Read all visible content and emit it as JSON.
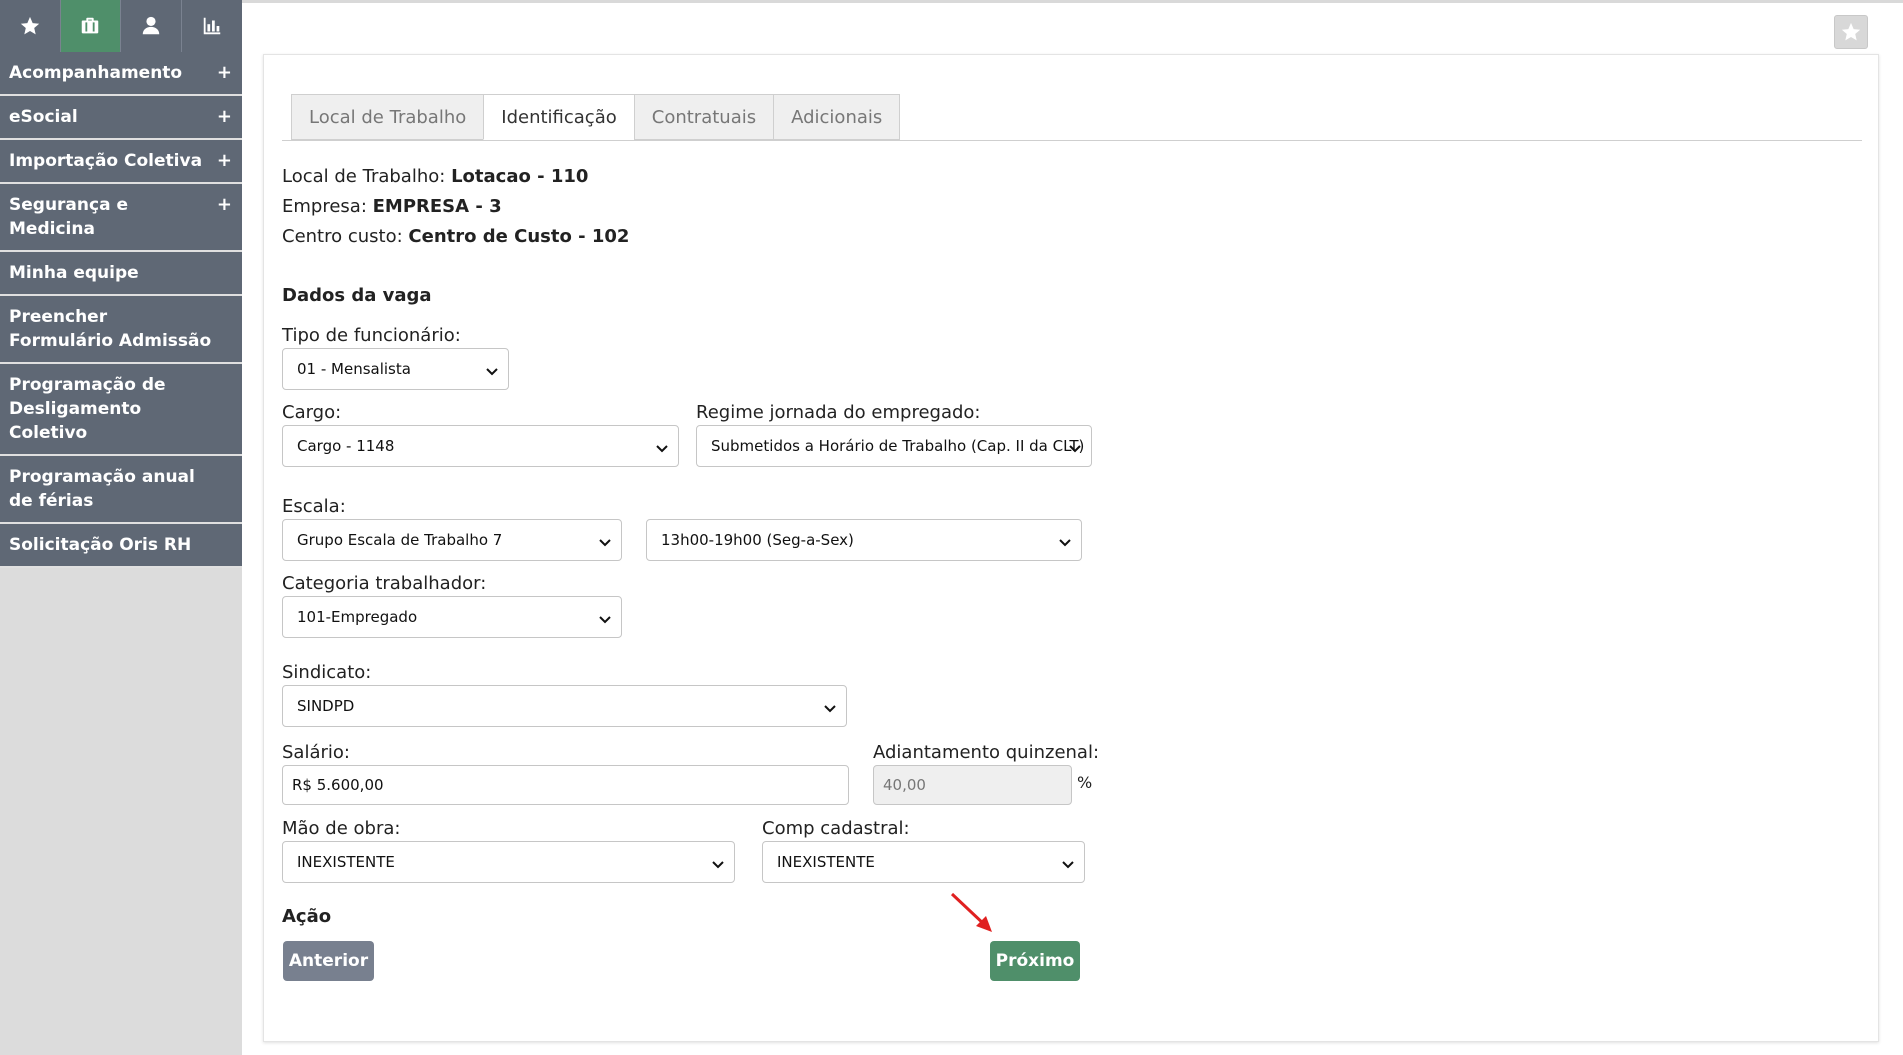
{
  "sidebar": {
    "tabs": [
      {
        "icon": "star-icon",
        "active": false
      },
      {
        "icon": "briefcase-icon",
        "active": true
      },
      {
        "icon": "user-icon",
        "active": false
      },
      {
        "icon": "bar-chart-icon",
        "active": false
      }
    ],
    "items": [
      {
        "label": "Acompanhamento",
        "plus": "+"
      },
      {
        "label": "eSocial",
        "plus": "+"
      },
      {
        "label": "Importação Coletiva",
        "plus": "+"
      },
      {
        "label": "Segurança e Medicina",
        "plus": "+"
      },
      {
        "label": "Minha equipe"
      },
      {
        "label": "Preencher Formulário Admissão"
      },
      {
        "label": "Programação de Desligamento Coletivo"
      },
      {
        "label": "Programação anual de férias"
      },
      {
        "label": "Solicitação Oris RH"
      }
    ]
  },
  "tabs": [
    "Local de Trabalho",
    "Identificação",
    "Contratuais",
    "Adicionais"
  ],
  "active_tab": "Identificação",
  "info": {
    "local_label": "Local de Trabalho:",
    "local_value": "Lotacao - 110",
    "empresa_label": "Empresa:",
    "empresa_value": "EMPRESA - 3",
    "centro_label": "Centro custo:",
    "centro_value": "Centro de Custo - 102"
  },
  "dados_vaga_title": "Dados da vaga",
  "fields": {
    "tipo_label": "Tipo de funcionário:",
    "tipo_value": "01 - Mensalista",
    "cargo_label": "Cargo:",
    "cargo_value": "Cargo - 1148",
    "regime_label": "Regime jornada do empregado:",
    "regime_value": "Submetidos a Horário de Trabalho (Cap. II da CLT)",
    "escala_label": "Escala:",
    "escala_grupo_value": "Grupo Escala de Trabalho 7",
    "escala_horario_value": "13h00-19h00 (Seg-a-Sex)",
    "categoria_label": "Categoria trabalhador:",
    "categoria_value": "101-Empregado",
    "sindicato_label": "Sindicato:",
    "sindicato_value": "SINDPD",
    "salario_label": "Salário:",
    "salario_value": "R$ 5.600,00",
    "adiantamento_label": "Adiantamento quinzenal:",
    "adiantamento_value": "40,00",
    "adiantamento_unit": "%",
    "mao_obra_label": "Mão de obra:",
    "mao_obra_value": "INEXISTENTE",
    "comp_label": "Comp cadastral:",
    "comp_value": "INEXISTENTE"
  },
  "acao_title": "Ação",
  "buttons": {
    "anterior": "Anterior",
    "proximo": "Próximo"
  },
  "colors": {
    "sidebar_bg": "#5f6875",
    "accent_green": "#4f8f6a",
    "arrow_red": "#e02020"
  }
}
